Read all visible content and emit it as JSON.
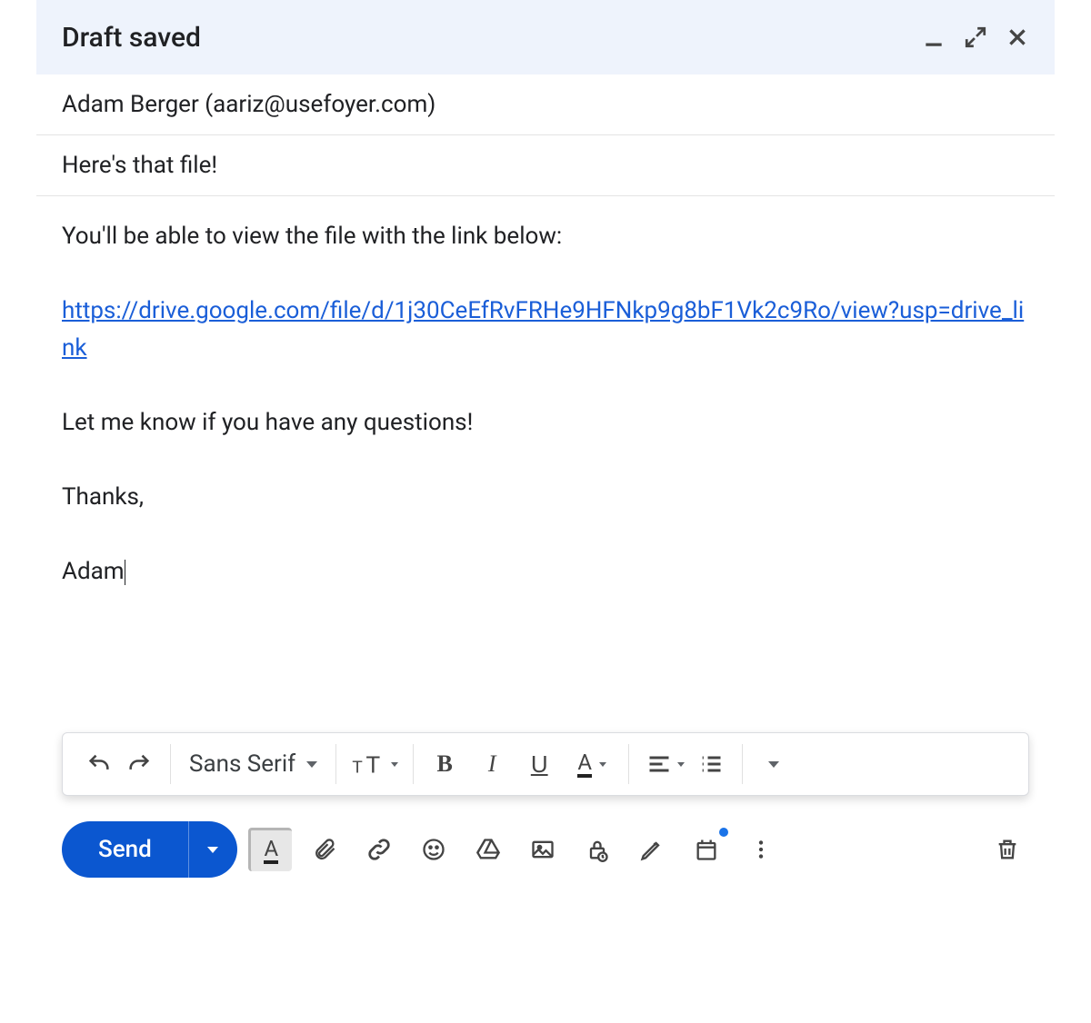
{
  "header": {
    "title": "Draft saved"
  },
  "recipient": "Adam Berger (aariz@usefoyer.com)",
  "subject": "Here's that file!",
  "body": {
    "intro": "You'll be able to view the file with the link below:",
    "link": "https://drive.google.com/file/d/1j30CeEfRvFRHe9HFNkp9g8bF1Vk2c9Ro/view?usp=drive_link",
    "outro": "Let me know if you have any questions!",
    "signoff1": "Thanks,",
    "signoff2": "Adam"
  },
  "format_toolbar": {
    "font": "Sans Serif"
  },
  "actions": {
    "send": "Send"
  }
}
